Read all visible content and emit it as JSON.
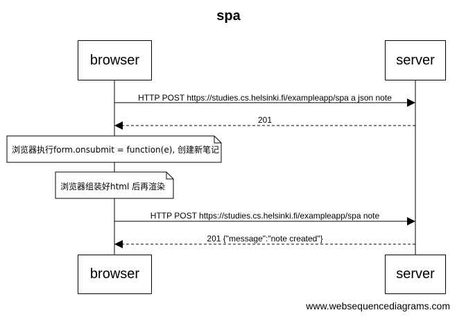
{
  "diagram": {
    "title": "spa",
    "participants": [
      {
        "id": "browser",
        "label": "browser"
      },
      {
        "id": "server",
        "label": "server"
      }
    ],
    "messages": [
      {
        "from": "browser",
        "to": "server",
        "style": "solid",
        "label": "HTTP POST https://studies.cs.helsinki.fi/exampleapp/spa a json note"
      },
      {
        "from": "server",
        "to": "browser",
        "style": "dashed",
        "label": "201"
      },
      {
        "from": "server",
        "to": "browser",
        "style": "dashed",
        "label": "201 {\"message\":\"note created\"}"
      },
      {
        "from": "browser",
        "to": "server",
        "style": "solid",
        "label": "HTTP POST https://studies.cs.helsinki.fi/exampleapp/spa note"
      }
    ],
    "notes": [
      {
        "over": "browser",
        "text": "浏览器执行form.onsubmit = function(e), 创建新笔记"
      },
      {
        "over": "browser",
        "text": "浏览器组装好html 后再渲染"
      }
    ]
  },
  "watermark": "www.websequencediagrams.com"
}
